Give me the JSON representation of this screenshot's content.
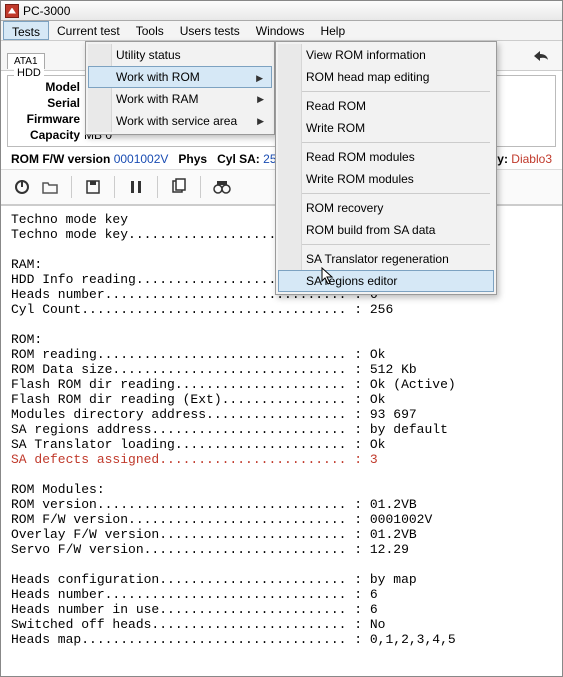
{
  "app": {
    "title": "PC-3000"
  },
  "menubar": [
    "Tests",
    "Current test",
    "Tools",
    "Users tests",
    "Windows",
    "Help"
  ],
  "toolbar": {
    "tab": "ATA1"
  },
  "hdd": {
    "legend": "HDD",
    "labels": {
      "model": "Model",
      "serial": "Serial",
      "firmware": "Firmware",
      "capacity": "Capacity"
    },
    "capacity_value": "MB 0"
  },
  "status": {
    "rom_fw_label": "ROM F/W version",
    "rom_fw_value": "0001002V",
    "phys_label": "Phys",
    "cyl_sa_label": "Cyl SA:",
    "cyl_sa_value": "256",
    "family_label": "Family:",
    "family_value": "Diablo3"
  },
  "menus": {
    "tests": {
      "utility_status": "Utility status",
      "work_with_rom": "Work with ROM",
      "work_with_ram": "Work with RAM",
      "work_with_sa": "Work with service area"
    },
    "rom": {
      "view_info": "View ROM information",
      "head_map": "ROM head map editing",
      "read_rom": "Read ROM",
      "write_rom": "Write ROM",
      "read_modules": "Read ROM modules",
      "write_modules": "Write ROM modules",
      "recovery": "ROM recovery",
      "build_sa": "ROM build from SA data",
      "sa_translator": "SA Translator regeneration",
      "sa_regions": "SA regions editor"
    }
  },
  "log_lines": [
    {
      "text": "Techno mode key"
    },
    {
      "text": "Techno mode key............................ : Ok"
    },
    {
      "text": ""
    },
    {
      "text": "RAM:"
    },
    {
      "text": "HDD Info reading........................... : Ok"
    },
    {
      "text": "Heads number............................... : 6"
    },
    {
      "text": "Cyl Count.................................. : 256"
    },
    {
      "text": ""
    },
    {
      "text": "ROM:"
    },
    {
      "text": "ROM reading................................ : Ok"
    },
    {
      "text": "ROM Data size.............................. : 512 Kb"
    },
    {
      "text": "Flash ROM dir reading...................... : Ok (Active)"
    },
    {
      "text": "Flash ROM dir reading (Ext)................ : Ok"
    },
    {
      "text": "Modules directory address.................. : 93 697"
    },
    {
      "text": "SA regions address......................... : by default"
    },
    {
      "text": "SA Translator loading...................... : Ok"
    },
    {
      "text": "SA defects assigned........................ : 3",
      "red": true
    },
    {
      "text": ""
    },
    {
      "text": "ROM Modules:"
    },
    {
      "text": "ROM version................................ : 01.2VB"
    },
    {
      "text": "ROM F/W version............................ : 0001002V"
    },
    {
      "text": "Overlay F/W version........................ : 01.2VB"
    },
    {
      "text": "Servo F/W version.......................... : 12.29"
    },
    {
      "text": ""
    },
    {
      "text": "Heads configuration........................ : by map"
    },
    {
      "text": "Heads number............................... : 6"
    },
    {
      "text": "Heads number in use........................ : 6"
    },
    {
      "text": "Switched off heads......................... : No"
    },
    {
      "text": "Heads map.................................. : 0,1,2,3,4,5"
    }
  ]
}
